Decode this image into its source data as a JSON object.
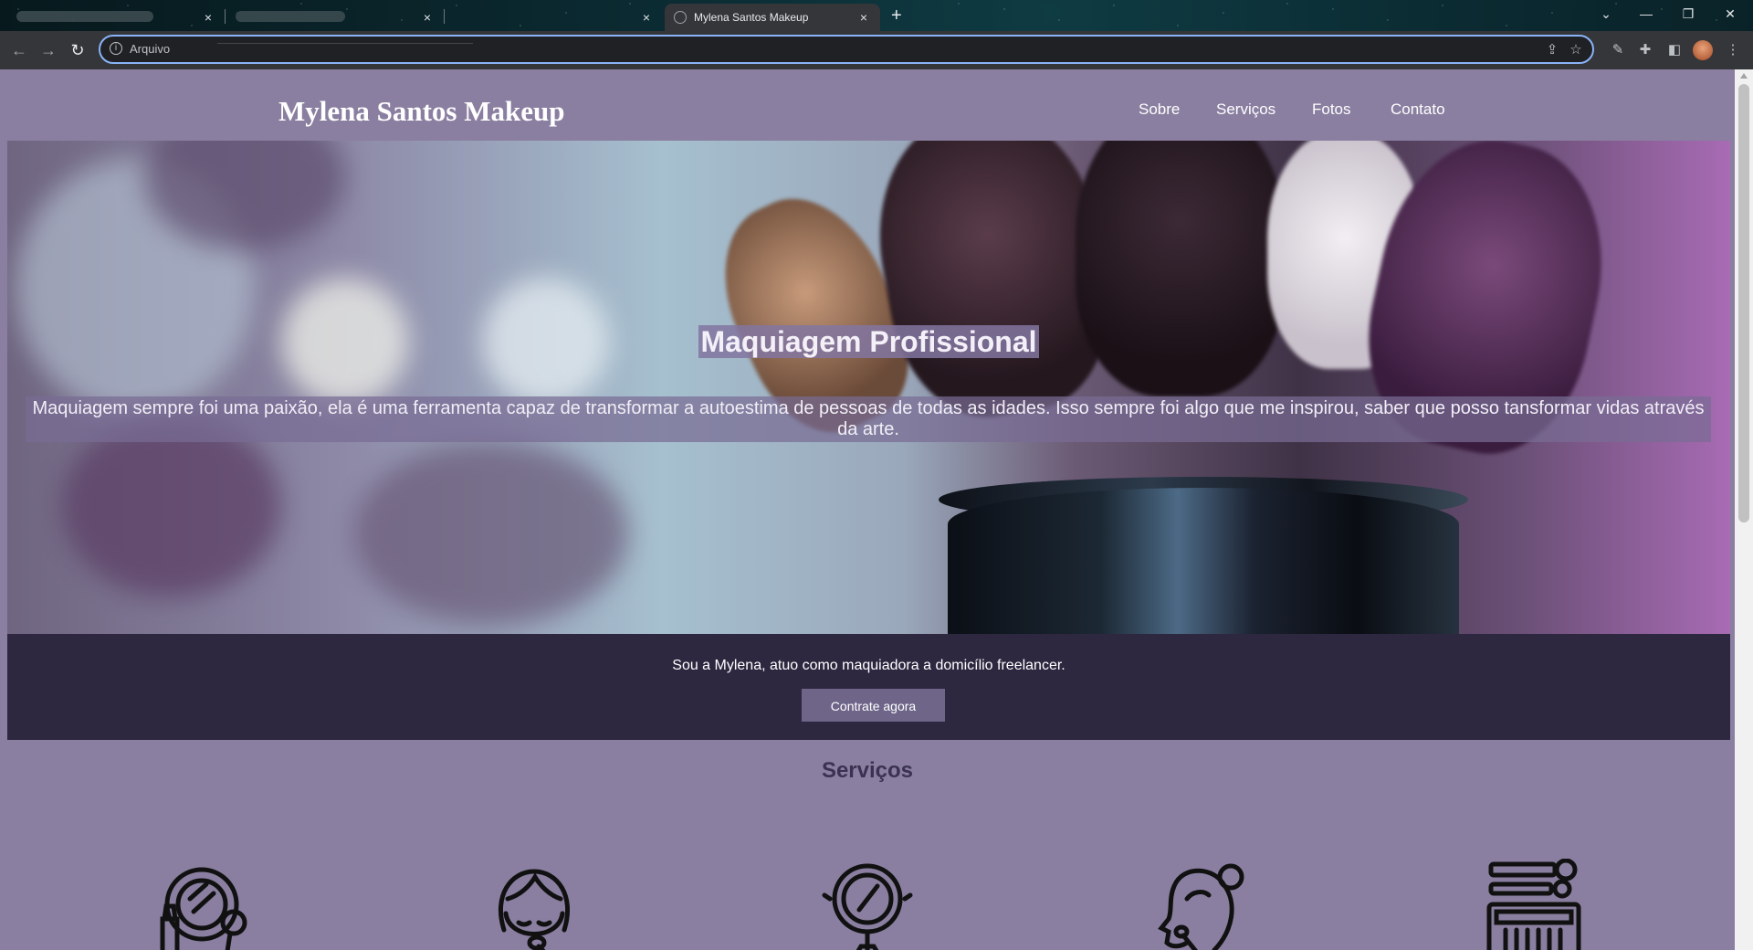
{
  "browser": {
    "tabs": [
      {
        "title": "",
        "close": "×"
      },
      {
        "title": "",
        "close": "×"
      },
      {
        "title": "",
        "close": "×"
      },
      {
        "title": "Mylena Santos Makeup",
        "close": "×",
        "active": true
      }
    ],
    "new_tab": "+",
    "window_controls": {
      "dropdown": "⌄",
      "minimize": "—",
      "restore": "❐",
      "close": "✕"
    },
    "address_bar": {
      "scheme_label": "Arquivo"
    },
    "nav": {
      "back": "←",
      "forward": "→",
      "reload": "↻"
    }
  },
  "site": {
    "logo": "Mylena Santos Makeup",
    "nav": [
      "Sobre",
      "Serviços",
      "Fotos",
      "Contato"
    ],
    "hero": {
      "title": "Maquiagem Profissional",
      "text": "Maquiagem sempre foi uma paixão, ela é uma ferramenta capaz de transformar a autoestima de pessoas de todas as idades. Isso sempre foi algo que me inspirou, saber que posso tansformar vidas através da arte."
    },
    "about": {
      "text": "Sou a Mylena, atuo como maquiadora a domicílio freelancer.",
      "cta": "Contrate agora"
    },
    "services": {
      "title": "Serviços",
      "icons": [
        "makeup-mirror-icon",
        "face-makeup-icon",
        "hand-mirror-icon",
        "woman-profile-icon",
        "eyeshadow-palette-icon"
      ]
    }
  },
  "colors": {
    "page_bg": "#8a7fa0",
    "about_bg": "#2e2740",
    "button_bg": "#6e6589",
    "services_title": "#3b3150"
  }
}
